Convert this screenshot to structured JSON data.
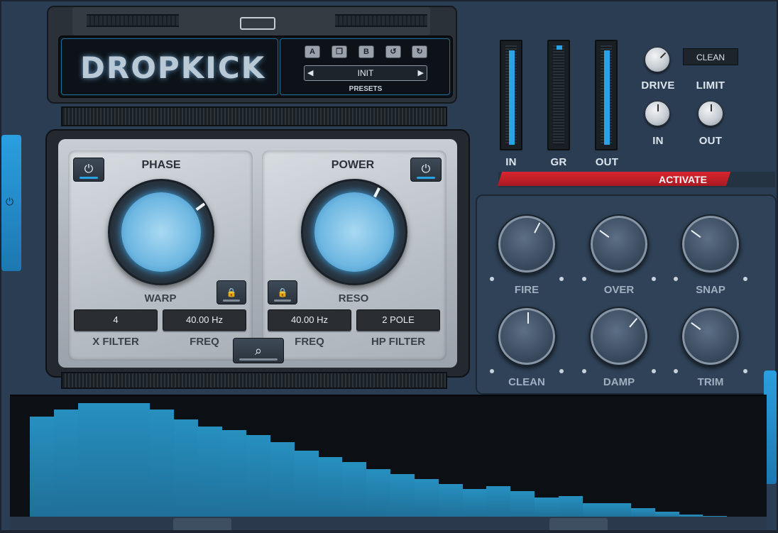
{
  "app": {
    "title": "DROPKICK"
  },
  "presets": {
    "buttons": [
      "A",
      "copy",
      "B",
      "undo",
      "redo"
    ],
    "current": "INIT",
    "label": "PRESETS"
  },
  "phase_panel": {
    "title": "PHASE",
    "knob_label": "WARP",
    "knob_value": 0.7,
    "filter_value": "4",
    "filter_label": "X FILTER",
    "freq_value": "40.00 Hz",
    "freq_label": "FREQ"
  },
  "power_panel": {
    "title": "POWER",
    "knob_label": "RESO",
    "knob_value": 0.6,
    "freq_value": "40.00 Hz",
    "freq_label": "FREQ",
    "filter_value": "2 POLE",
    "filter_label": "HP FILTER"
  },
  "meters": [
    {
      "label": "IN",
      "level": 0.95
    },
    {
      "label": "GR",
      "level": 0.04
    },
    {
      "label": "OUT",
      "level": 0.95
    }
  ],
  "dynamics": {
    "mode": "CLEAN",
    "drive_label": "DRIVE",
    "limit_label": "LIMIT",
    "in_label": "IN",
    "out_label": "OUT"
  },
  "activate_label": "ACTIVATE",
  "macro_knobs": [
    {
      "label": "FIRE",
      "value": 0.6
    },
    {
      "label": "OVER",
      "value": 0.3
    },
    {
      "label": "SNAP",
      "value": 0.3
    },
    {
      "label": "CLEAN",
      "value": 0.5
    },
    {
      "label": "DAMP",
      "value": 0.65
    },
    {
      "label": "TRIM",
      "value": 0.3
    }
  ],
  "spectrum": {
    "levels": [
      0.83,
      0.89,
      0.94,
      0.94,
      0.94,
      0.89,
      0.81,
      0.75,
      0.72,
      0.68,
      0.62,
      0.55,
      0.5,
      0.46,
      0.4,
      0.36,
      0.32,
      0.28,
      0.24,
      0.26,
      0.22,
      0.17,
      0.18,
      0.12,
      0.12,
      0.08,
      0.05,
      0.03,
      0.02,
      0.01
    ]
  },
  "colors": {
    "accent": "#2aa3e6",
    "activate": "#c8202a",
    "panel": "#2b3d52"
  }
}
